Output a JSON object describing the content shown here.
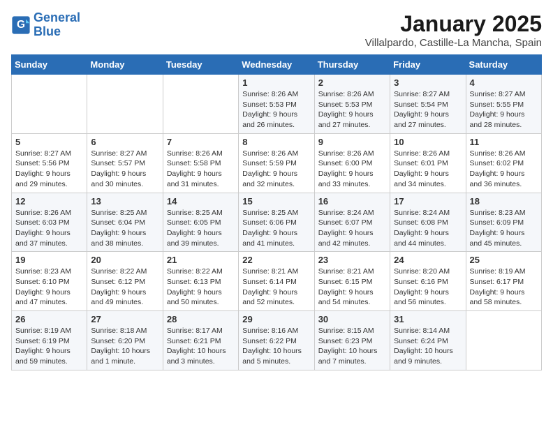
{
  "logo": {
    "line1": "General",
    "line2": "Blue"
  },
  "title": "January 2025",
  "subtitle": "Villalpardo, Castille-La Mancha, Spain",
  "weekdays": [
    "Sunday",
    "Monday",
    "Tuesday",
    "Wednesday",
    "Thursday",
    "Friday",
    "Saturday"
  ],
  "weeks": [
    [
      {
        "day": "",
        "info": ""
      },
      {
        "day": "",
        "info": ""
      },
      {
        "day": "",
        "info": ""
      },
      {
        "day": "1",
        "info": "Sunrise: 8:26 AM\nSunset: 5:53 PM\nDaylight: 9 hours and 26 minutes."
      },
      {
        "day": "2",
        "info": "Sunrise: 8:26 AM\nSunset: 5:53 PM\nDaylight: 9 hours and 27 minutes."
      },
      {
        "day": "3",
        "info": "Sunrise: 8:27 AM\nSunset: 5:54 PM\nDaylight: 9 hours and 27 minutes."
      },
      {
        "day": "4",
        "info": "Sunrise: 8:27 AM\nSunset: 5:55 PM\nDaylight: 9 hours and 28 minutes."
      }
    ],
    [
      {
        "day": "5",
        "info": "Sunrise: 8:27 AM\nSunset: 5:56 PM\nDaylight: 9 hours and 29 minutes."
      },
      {
        "day": "6",
        "info": "Sunrise: 8:27 AM\nSunset: 5:57 PM\nDaylight: 9 hours and 30 minutes."
      },
      {
        "day": "7",
        "info": "Sunrise: 8:26 AM\nSunset: 5:58 PM\nDaylight: 9 hours and 31 minutes."
      },
      {
        "day": "8",
        "info": "Sunrise: 8:26 AM\nSunset: 5:59 PM\nDaylight: 9 hours and 32 minutes."
      },
      {
        "day": "9",
        "info": "Sunrise: 8:26 AM\nSunset: 6:00 PM\nDaylight: 9 hours and 33 minutes."
      },
      {
        "day": "10",
        "info": "Sunrise: 8:26 AM\nSunset: 6:01 PM\nDaylight: 9 hours and 34 minutes."
      },
      {
        "day": "11",
        "info": "Sunrise: 8:26 AM\nSunset: 6:02 PM\nDaylight: 9 hours and 36 minutes."
      }
    ],
    [
      {
        "day": "12",
        "info": "Sunrise: 8:26 AM\nSunset: 6:03 PM\nDaylight: 9 hours and 37 minutes."
      },
      {
        "day": "13",
        "info": "Sunrise: 8:25 AM\nSunset: 6:04 PM\nDaylight: 9 hours and 38 minutes."
      },
      {
        "day": "14",
        "info": "Sunrise: 8:25 AM\nSunset: 6:05 PM\nDaylight: 9 hours and 39 minutes."
      },
      {
        "day": "15",
        "info": "Sunrise: 8:25 AM\nSunset: 6:06 PM\nDaylight: 9 hours and 41 minutes."
      },
      {
        "day": "16",
        "info": "Sunrise: 8:24 AM\nSunset: 6:07 PM\nDaylight: 9 hours and 42 minutes."
      },
      {
        "day": "17",
        "info": "Sunrise: 8:24 AM\nSunset: 6:08 PM\nDaylight: 9 hours and 44 minutes."
      },
      {
        "day": "18",
        "info": "Sunrise: 8:23 AM\nSunset: 6:09 PM\nDaylight: 9 hours and 45 minutes."
      }
    ],
    [
      {
        "day": "19",
        "info": "Sunrise: 8:23 AM\nSunset: 6:10 PM\nDaylight: 9 hours and 47 minutes."
      },
      {
        "day": "20",
        "info": "Sunrise: 8:22 AM\nSunset: 6:12 PM\nDaylight: 9 hours and 49 minutes."
      },
      {
        "day": "21",
        "info": "Sunrise: 8:22 AM\nSunset: 6:13 PM\nDaylight: 9 hours and 50 minutes."
      },
      {
        "day": "22",
        "info": "Sunrise: 8:21 AM\nSunset: 6:14 PM\nDaylight: 9 hours and 52 minutes."
      },
      {
        "day": "23",
        "info": "Sunrise: 8:21 AM\nSunset: 6:15 PM\nDaylight: 9 hours and 54 minutes."
      },
      {
        "day": "24",
        "info": "Sunrise: 8:20 AM\nSunset: 6:16 PM\nDaylight: 9 hours and 56 minutes."
      },
      {
        "day": "25",
        "info": "Sunrise: 8:19 AM\nSunset: 6:17 PM\nDaylight: 9 hours and 58 minutes."
      }
    ],
    [
      {
        "day": "26",
        "info": "Sunrise: 8:19 AM\nSunset: 6:19 PM\nDaylight: 9 hours and 59 minutes."
      },
      {
        "day": "27",
        "info": "Sunrise: 8:18 AM\nSunset: 6:20 PM\nDaylight: 10 hours and 1 minute."
      },
      {
        "day": "28",
        "info": "Sunrise: 8:17 AM\nSunset: 6:21 PM\nDaylight: 10 hours and 3 minutes."
      },
      {
        "day": "29",
        "info": "Sunrise: 8:16 AM\nSunset: 6:22 PM\nDaylight: 10 hours and 5 minutes."
      },
      {
        "day": "30",
        "info": "Sunrise: 8:15 AM\nSunset: 6:23 PM\nDaylight: 10 hours and 7 minutes."
      },
      {
        "day": "31",
        "info": "Sunrise: 8:14 AM\nSunset: 6:24 PM\nDaylight: 10 hours and 9 minutes."
      },
      {
        "day": "",
        "info": ""
      }
    ]
  ]
}
